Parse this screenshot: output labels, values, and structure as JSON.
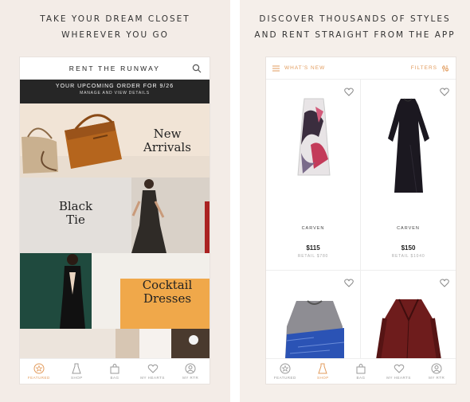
{
  "left": {
    "caption_line1": "TAKE YOUR DREAM CLOSET",
    "caption_line2": "WHEREVER YOU GO",
    "brand": "RENT THE RUNWAY",
    "order_title": "YOUR UPCOMING ORDER FOR 9/26",
    "order_sub": "MANAGE AND VIEW DETAILS",
    "categories": [
      {
        "line1": "New",
        "line2": "Arrivals"
      },
      {
        "line1": "Black",
        "line2": "Tie"
      },
      {
        "line1": "Cocktail",
        "line2": "Dresses"
      }
    ],
    "tabs": [
      "FEATURED",
      "SHOP",
      "BAG",
      "MY HEARTS",
      "MY RTR"
    ],
    "active_tab": "FEATURED"
  },
  "right": {
    "caption_line1": "DISCOVER THOUSANDS OF STYLES",
    "caption_line2": "AND RENT STRAIGHT FROM THE APP",
    "whats_new": "WHAT'S NEW",
    "filters": "FILTERS",
    "products": [
      {
        "designer": "CARVEN",
        "price": "$115",
        "retail": "RETAIL $780"
      },
      {
        "designer": "CARVEN",
        "price": "$150",
        "retail": "RETAIL $1040"
      },
      {
        "designer": "",
        "price": "",
        "retail": ""
      },
      {
        "designer": "",
        "price": "",
        "retail": ""
      }
    ],
    "tabs": [
      "FEATURED",
      "SHOP",
      "BAG",
      "MY HEARTS",
      "MY RTR"
    ],
    "active_tab": "SHOP"
  },
  "colors": {
    "accent": "#e29b5c",
    "banner": "#262626",
    "cocktail_block": "#f0a84a"
  }
}
